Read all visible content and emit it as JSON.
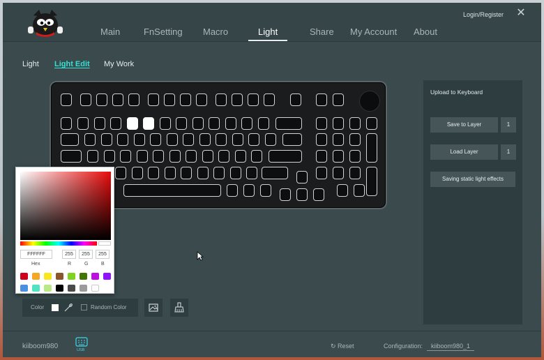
{
  "header": {
    "nav": [
      {
        "label": "Main",
        "active": false
      },
      {
        "label": "FnSetting",
        "active": false
      },
      {
        "label": "Macro",
        "active": false
      },
      {
        "label": "Light",
        "active": true
      },
      {
        "label": "Share",
        "active": false
      },
      {
        "label": "My Account",
        "active": false
      },
      {
        "label": "About",
        "active": false
      }
    ],
    "login_label": "Login/Register",
    "close_icon": "close-icon"
  },
  "subtabs": [
    {
      "label": "Light",
      "active": false
    },
    {
      "label": "Light Edit",
      "active": true
    },
    {
      "label": "My Work",
      "active": false
    }
  ],
  "panel": {
    "title": "Upload to Keyboard",
    "save_label": "Save to Layer",
    "save_layer": "1",
    "load_label": "Load Layer",
    "load_layer": "1",
    "static_label": "Saving static light effects"
  },
  "picker": {
    "hex_value": "FFFFFF",
    "r_value": "255",
    "g_value": "255",
    "b_value": "255",
    "hex_label": "Hex",
    "r_label": "R",
    "g_label": "G",
    "b_label": "B",
    "swatches_row1": [
      "#d0021b",
      "#f5a623",
      "#f8e71c",
      "#8b572a",
      "#7ed321",
      "#417505",
      "#bd10e0",
      "#9013fe"
    ],
    "swatches_row2": [
      "#4a90e2",
      "#50e3c2",
      "#b8e986",
      "#000000",
      "#4a4a4a",
      "#9b9b9b",
      "#ffffff"
    ]
  },
  "toolbar": {
    "color_label": "Color",
    "selected_color": "#ffffff",
    "random_label": "Random Color",
    "random_checked": false
  },
  "footer": {
    "device_name": "kiiboom980",
    "usb_label": "USB",
    "reset_label": "Reset",
    "config_label": "Configuration:",
    "config_value": "kiiboom980_1"
  },
  "colors": {
    "accent": "#35e0d4",
    "background": "#3a4a4d",
    "panel": "#2e3d40"
  }
}
